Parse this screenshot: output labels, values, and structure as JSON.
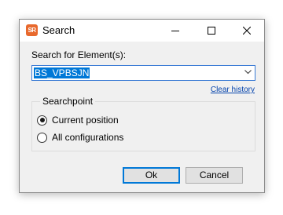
{
  "window": {
    "title": "Search",
    "icon_text": "SR"
  },
  "search": {
    "label": "Search for Element(s):",
    "value": "BS_VPBSJN",
    "clear_history": "Clear history"
  },
  "searchpoint": {
    "title": "Searchpoint",
    "options": [
      {
        "label": "Current position",
        "checked": true
      },
      {
        "label": "All configurations",
        "checked": false
      }
    ]
  },
  "buttons": {
    "ok": "Ok",
    "cancel": "Cancel"
  },
  "colors": {
    "accent": "#0078d7",
    "app_icon": "#e8692d",
    "link": "#0645ad"
  }
}
